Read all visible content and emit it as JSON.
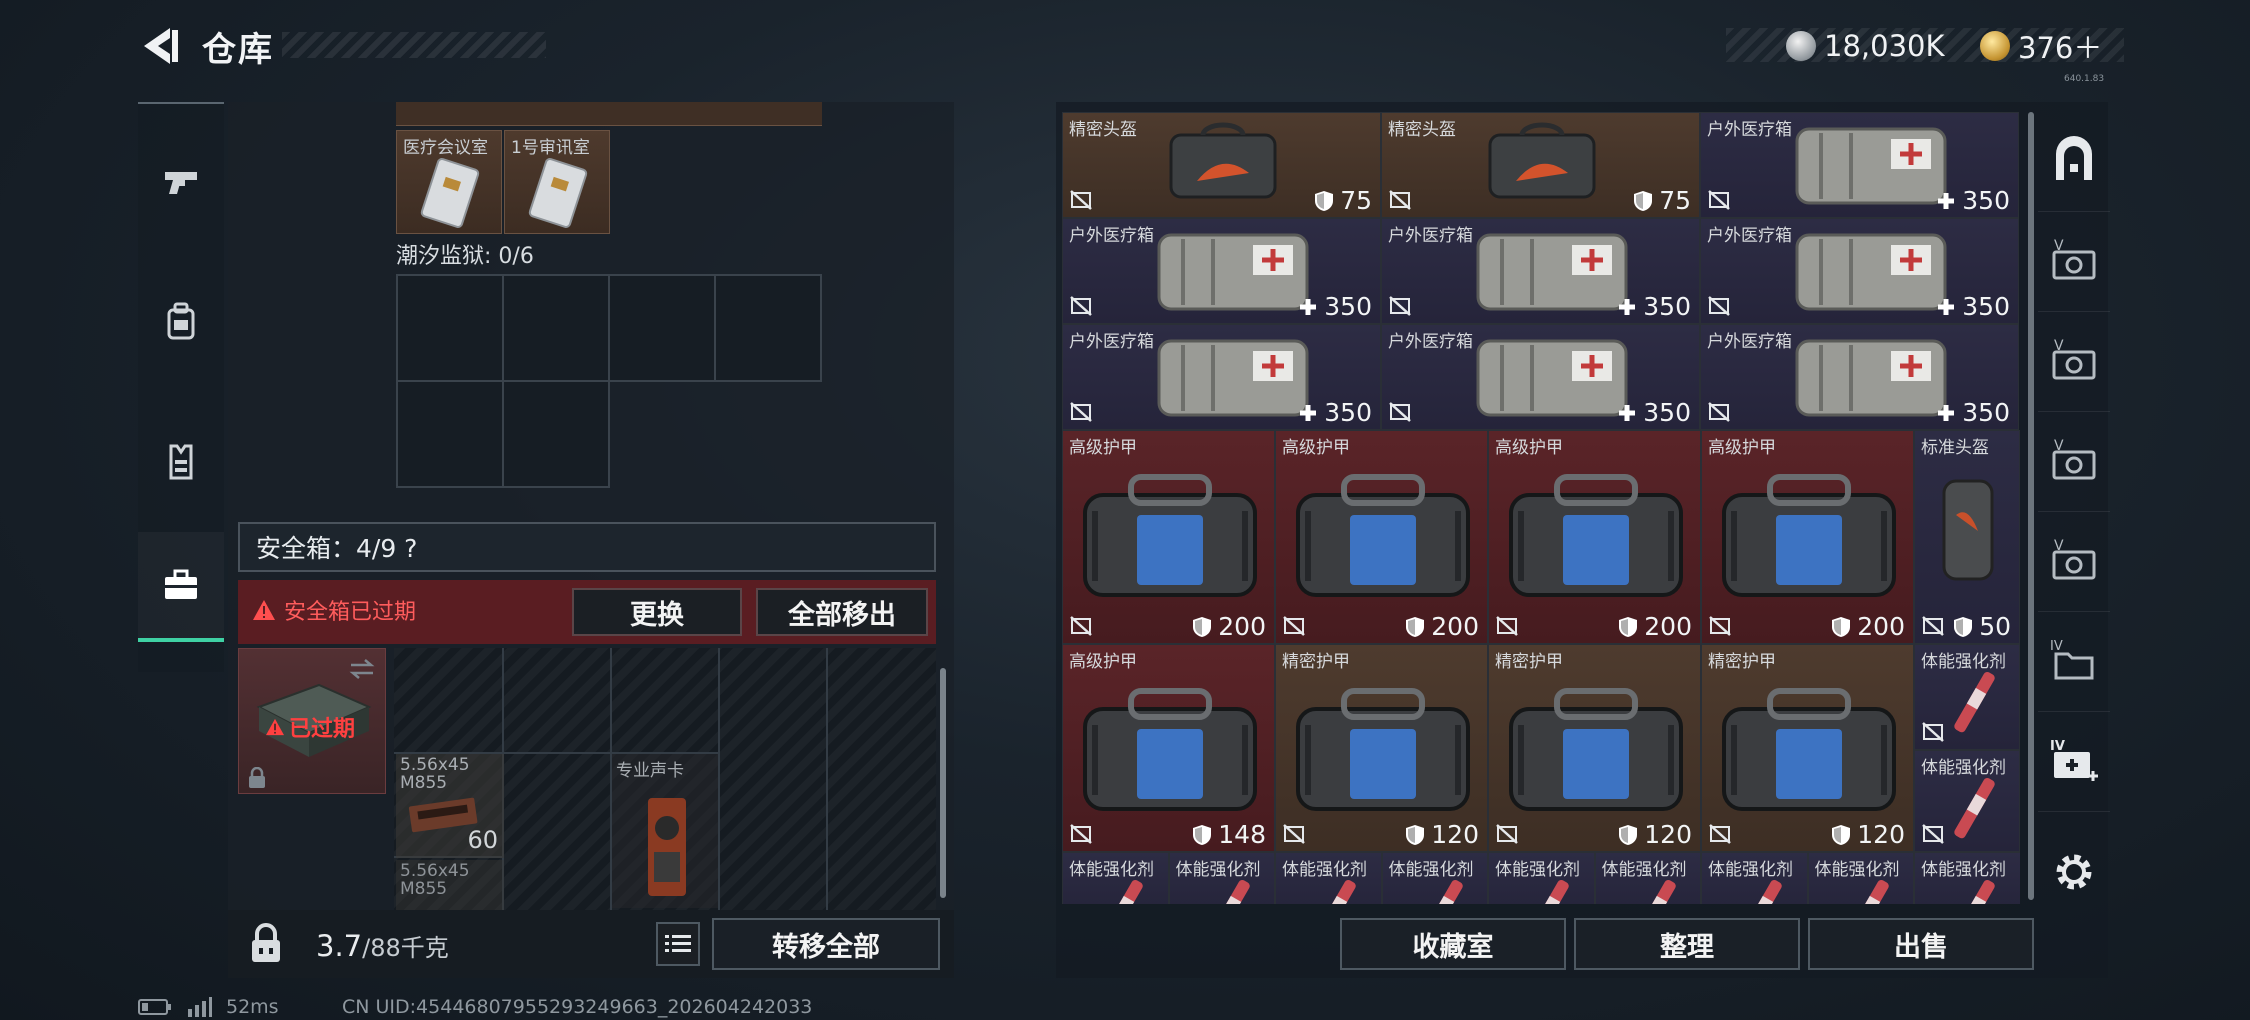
{
  "header": {
    "title": "仓库",
    "currency_silver": "18,030K",
    "currency_gold": "376＋",
    "version": "640.1.83"
  },
  "left_nav": {
    "items": [
      {
        "icon": "pistol-icon",
        "active": false
      },
      {
        "icon": "backpack-icon",
        "active": false
      },
      {
        "icon": "vest-icon",
        "active": false
      },
      {
        "icon": "briefcase-icon",
        "active": true
      }
    ]
  },
  "keycards": {
    "items": [
      {
        "name": "医疗会议室"
      },
      {
        "name": "1号审讯室"
      }
    ],
    "section_label": "潮汐监狱: 0/6"
  },
  "safebox": {
    "label": "安全箱：4/9 ?",
    "expired_text": "安全箱已过期",
    "replace_button": "更换",
    "move_all_button": "全部移出",
    "expired_badge": "已过期",
    "items": [
      {
        "name": "5.56x45 M855",
        "count": "60"
      },
      {
        "name": "专业声卡",
        "count": ""
      },
      {
        "name": "5.56x45 M855",
        "count": ""
      }
    ]
  },
  "left_bottom": {
    "weight": "3.7",
    "weight_max": "/88千克",
    "transfer_all": "转移全部"
  },
  "stash": {
    "rows": [
      [
        {
          "name": "精密头盔",
          "value": "75",
          "type": "shield",
          "bg": "brown"
        },
        {
          "name": "精密头盔",
          "value": "75",
          "type": "shield",
          "bg": "brown"
        },
        {
          "name": "户外医疗箱",
          "value": "350",
          "type": "plus",
          "bg": "purple"
        }
      ],
      [
        {
          "name": "户外医疗箱",
          "value": "350",
          "type": "plus",
          "bg": "purple"
        },
        {
          "name": "户外医疗箱",
          "value": "350",
          "type": "plus",
          "bg": "purple"
        },
        {
          "name": "户外医疗箱",
          "value": "350",
          "type": "plus",
          "bg": "purple"
        }
      ],
      [
        {
          "name": "户外医疗箱",
          "value": "350",
          "type": "plus",
          "bg": "purple"
        },
        {
          "name": "户外医疗箱",
          "value": "350",
          "type": "plus",
          "bg": "purple"
        },
        {
          "name": "户外医疗箱",
          "value": "350",
          "type": "plus",
          "bg": "purple"
        }
      ],
      [
        {
          "name": "高级护甲",
          "value": "200",
          "type": "shield",
          "bg": "red"
        },
        {
          "name": "高级护甲",
          "value": "200",
          "type": "shield",
          "bg": "red"
        },
        {
          "name": "高级护甲",
          "value": "200",
          "type": "shield",
          "bg": "red"
        },
        {
          "name": "高级护甲",
          "value": "200",
          "type": "shield",
          "bg": "red"
        },
        {
          "name": "标准头盔",
          "value": "50",
          "type": "shield",
          "bg": "purple"
        }
      ],
      [
        {
          "name": "高级护甲",
          "value": "148",
          "type": "shield",
          "bg": "red"
        },
        {
          "name": "精密护甲",
          "value": "120",
          "type": "shield",
          "bg": "brown"
        },
        {
          "name": "精密护甲",
          "value": "120",
          "type": "shield",
          "bg": "brown"
        },
        {
          "name": "精密护甲",
          "value": "120",
          "type": "shield",
          "bg": "brown"
        },
        {
          "name": "体能强化剂",
          "value": "",
          "type": "none",
          "bg": "purple"
        },
        {
          "name": "体能强化剂",
          "value": "",
          "type": "none",
          "bg": "purple"
        }
      ],
      [
        {
          "name": "体能强化剂"
        },
        {
          "name": "体能强化剂"
        },
        {
          "name": "体能强化剂"
        },
        {
          "name": "体能强化剂"
        },
        {
          "name": "体能强化剂"
        },
        {
          "name": "体能强化剂"
        },
        {
          "name": "体能强化剂"
        },
        {
          "name": "体能强化剂"
        },
        {
          "name": "体能强化剂"
        }
      ]
    ]
  },
  "right_bottom": {
    "collection_room": "收藏室",
    "organize": "整理",
    "sell": "出售"
  },
  "right_nav": {
    "items": [
      "vault-arch-icon",
      "vault-v-icon",
      "vault-v-icon",
      "vault-v-icon",
      "vault-v-icon",
      "vault-iv-icon",
      "vault-iv-add-icon",
      "settings-gear-icon"
    ]
  },
  "status": {
    "ping": "52ms",
    "uid": "CN UID:45446807955293249663_202604242033"
  },
  "colors": {
    "accent_green": "#3fd1a4",
    "expired_red": "#ff5c5c",
    "slot_purple": "#2d2c44",
    "slot_brown": "#4e3b2e",
    "slot_red": "#5a2428"
  }
}
